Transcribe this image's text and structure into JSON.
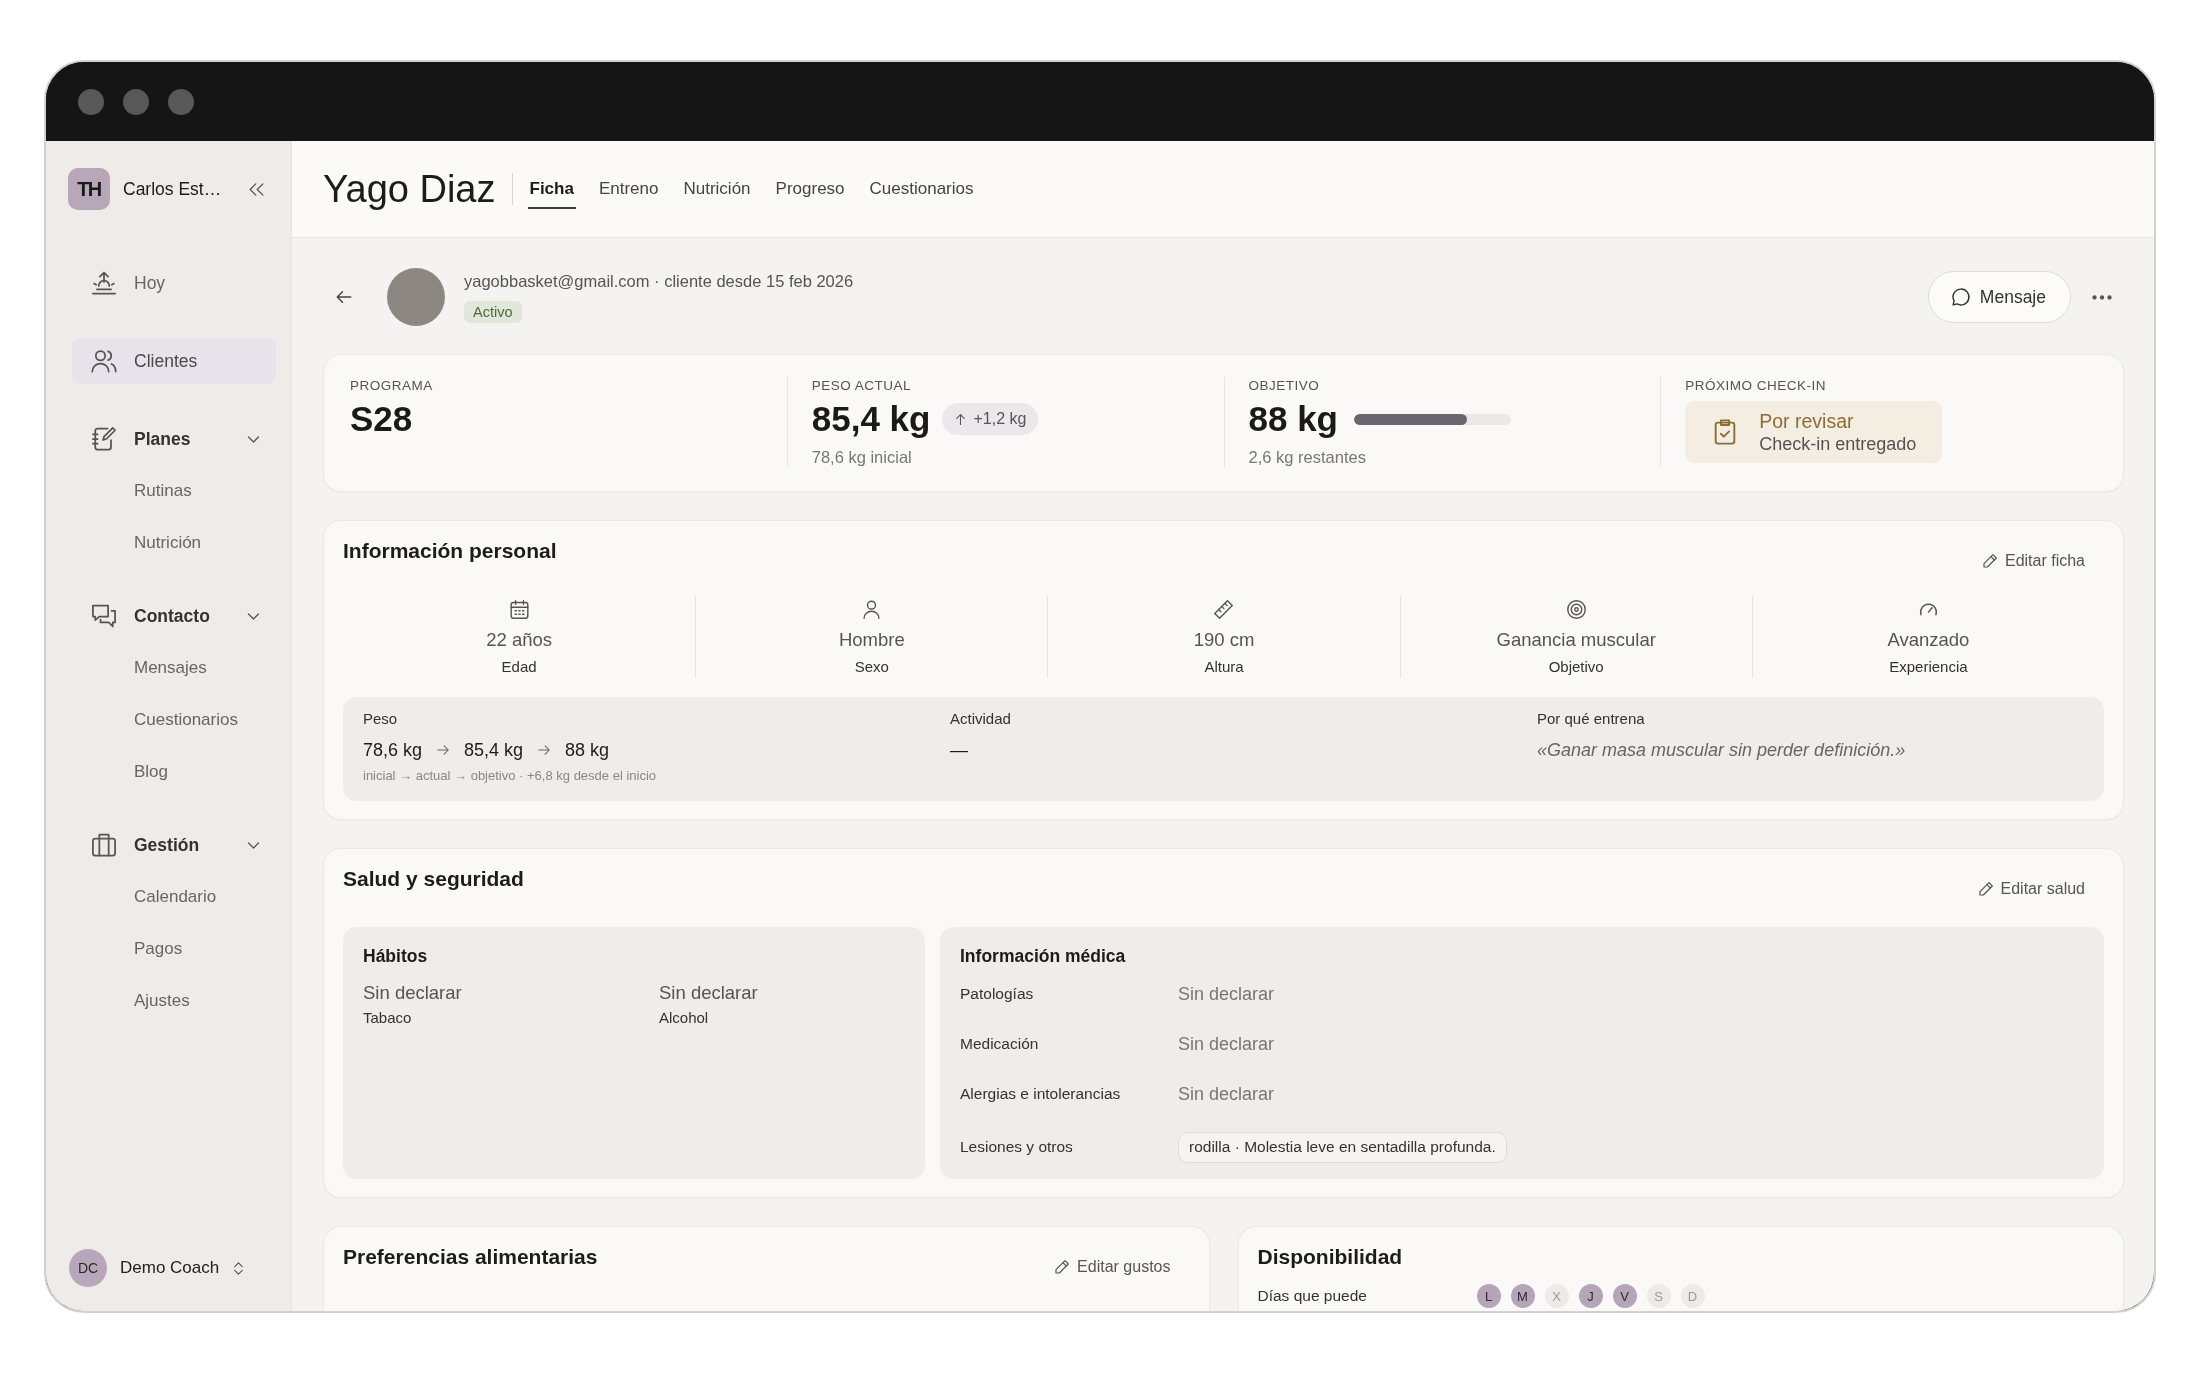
{
  "sidebar": {
    "workspace": {
      "logo": "TH",
      "name": "Carlos Est…"
    },
    "nav": [
      {
        "kind": "link",
        "label": "Hoy",
        "selected": false
      },
      {
        "kind": "link",
        "label": "Clientes",
        "selected": true
      },
      {
        "kind": "group",
        "label": "Planes",
        "selected": false,
        "expanded": true,
        "children": [
          {
            "label": "Rutinas",
            "selected": false
          },
          {
            "label": "Nutrición",
            "selected": false
          }
        ]
      },
      {
        "kind": "group",
        "label": "Contacto",
        "selected": false,
        "expanded": true,
        "children": [
          {
            "label": "Mensajes",
            "selected": false
          },
          {
            "label": "Cuestionarios",
            "selected": false
          },
          {
            "label": "Blog",
            "selected": false
          }
        ]
      },
      {
        "kind": "group",
        "label": "Gestión",
        "selected": false,
        "expanded": true,
        "children": [
          {
            "label": "Calendario",
            "selected": false
          },
          {
            "label": "Pagos",
            "selected": false
          },
          {
            "label": "Ajustes",
            "selected": false
          }
        ]
      }
    ],
    "user": {
      "initials": "DC",
      "name": "Demo Coach"
    }
  },
  "header": {
    "title": "Yago Diaz",
    "tabs": [
      {
        "label": "Ficha",
        "selected": true
      },
      {
        "label": "Entreno",
        "selected": false
      },
      {
        "label": "Nutrición",
        "selected": false
      },
      {
        "label": "Progreso",
        "selected": false
      },
      {
        "label": "Cuestionarios",
        "selected": false
      }
    ]
  },
  "client": {
    "contact": "yagobbasket@gmail.com · cliente desde 15 feb 2026",
    "status": "Activo",
    "message_button": "Mensaje"
  },
  "summary": [
    {
      "kind": "text",
      "label": "PROGRAMA",
      "value": "S28"
    },
    {
      "kind": "change",
      "label": "PESO ACTUAL",
      "value": "85,4 kg",
      "change": "+1,2 kg",
      "note": "78,6 kg inicial"
    },
    {
      "kind": "progress",
      "label": "OBJETIVO",
      "value": "88 kg",
      "level": 0.72,
      "note": "2,6 kg restantes"
    },
    {
      "kind": "status",
      "label": "PRÓXIMO CHECK-IN",
      "status": "Por revisar",
      "detail": "Check-in entregado"
    }
  ],
  "personal": {
    "title": "Información personal",
    "edit_button": "Editar ficha",
    "facts": [
      {
        "value": "22 años",
        "label": "Edad"
      },
      {
        "value": "Hombre",
        "label": "Sexo"
      },
      {
        "value": "190 cm",
        "label": "Altura"
      },
      {
        "value": "Ganancia muscular",
        "label": "Objetivo"
      },
      {
        "value": "Avanzado",
        "label": "Experiencia"
      }
    ],
    "weight": {
      "label": "Peso",
      "values": [
        "78,6 kg",
        "85,4 kg",
        "88 kg"
      ],
      "caption": "inicial → actual → objetivo · +6,8 kg desde el inicio"
    },
    "activity": {
      "label": "Actividad",
      "value": "—"
    },
    "motivation": {
      "label": "Por qué entrena",
      "value": "«Ganar masa muscular sin perder definición.»"
    }
  },
  "health": {
    "title": "Salud y seguridad",
    "edit_button": "Editar salud",
    "habits": {
      "title": "Hábitos",
      "items": [
        {
          "value": "Sin declarar",
          "label": "Tabaco"
        },
        {
          "value": "Sin declarar",
          "label": "Alcohol"
        }
      ]
    },
    "medical": {
      "title": "Información médica",
      "rows": [
        {
          "kind": "text",
          "label": "Patologías",
          "value": "Sin declarar"
        },
        {
          "kind": "text",
          "label": "Medicación",
          "value": "Sin declarar"
        },
        {
          "kind": "text",
          "label": "Alergias e intolerancias",
          "value": "Sin declarar"
        },
        {
          "kind": "tag",
          "label": "Lesiones y otros",
          "value": "rodilla · Molestia leve en sentadilla profunda."
        }
      ]
    }
  },
  "food_preferences": {
    "title": "Preferencias alimentarias",
    "edit_button": "Editar gustos"
  },
  "availability": {
    "title": "Disponibilidad",
    "days_label": "Días que puede",
    "days": [
      {
        "label": "L",
        "selected": true
      },
      {
        "label": "M",
        "selected": true
      },
      {
        "label": "X",
        "selected": false
      },
      {
        "label": "J",
        "selected": true
      },
      {
        "label": "V",
        "selected": true
      },
      {
        "label": "S",
        "selected": false
      },
      {
        "label": "D",
        "selected": false
      }
    ]
  }
}
